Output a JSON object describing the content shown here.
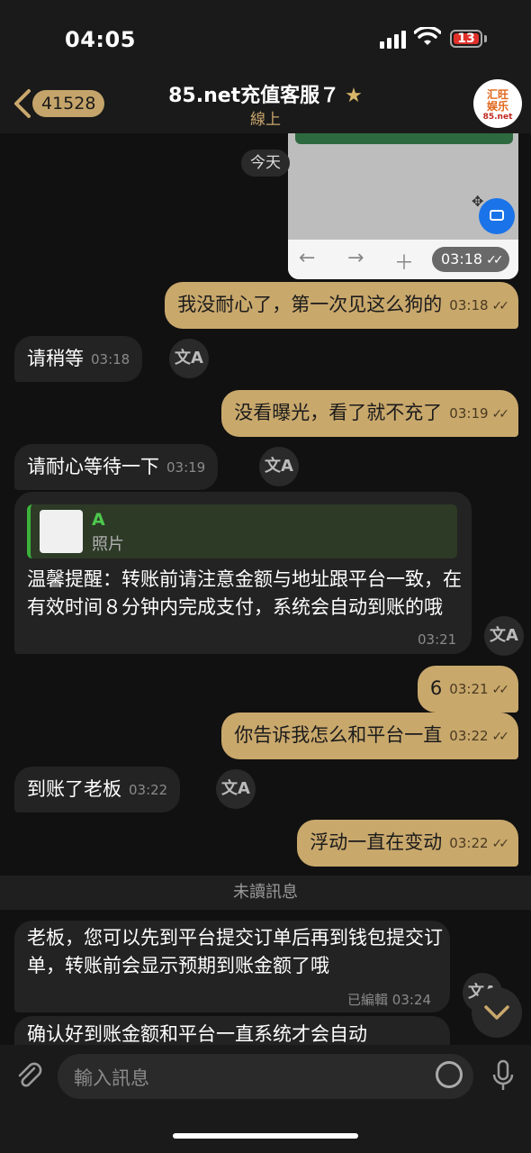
{
  "status_bar": {
    "time": "04:05",
    "battery": "13"
  },
  "header": {
    "back_count": "41528",
    "title": "85.net充值客服７",
    "subtitle": "線上",
    "avatar_line1": "汇旺",
    "avatar_line2": "娱乐",
    "avatar_line3": "85.net"
  },
  "date_pill": "今天",
  "image_message": {
    "time": "03:18"
  },
  "messages": [
    {
      "dir": "out",
      "text": "我没耐心了，第一次见这么狗的",
      "time": "03:18"
    },
    {
      "dir": "in",
      "text": "请稍等",
      "time": "03:18"
    },
    {
      "dir": "out",
      "text": "没看曝光，看了就不充了",
      "time": "03:19"
    },
    {
      "dir": "in",
      "text": "请耐心等待一下",
      "time": "03:19"
    },
    {
      "dir": "in",
      "reply_name": "A",
      "reply_type": "照片",
      "text": "温馨提醒：转账前请注意金额与地址跟平台一致，在有效时间８分钟内完成支付，系统会自动到账的哦",
      "time": "03:21"
    },
    {
      "dir": "out",
      "text": "6",
      "time": "03:21"
    },
    {
      "dir": "out",
      "text": "你告诉我怎么和平台一直",
      "time": "03:22"
    },
    {
      "dir": "in",
      "text": "到账了老板",
      "time": "03:22"
    },
    {
      "dir": "out",
      "text": "浮动一直在变动",
      "time": "03:22"
    },
    {
      "dir": "in",
      "text": "老板，您可以先到平台提交订单后再到钱包提交订单，转账前会显示预期到账金额了哦",
      "edited": "已編輯",
      "time": "03:24"
    },
    {
      "dir": "in",
      "text": "确认好到账金额和平台一直系统才会自动"
    }
  ],
  "unread_label": "未讀訊息",
  "input": {
    "placeholder": "輸入訊息"
  }
}
